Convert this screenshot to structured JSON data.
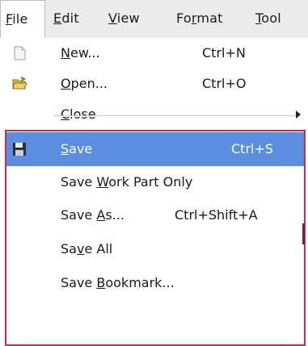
{
  "menubar": {
    "file": {
      "pre": "",
      "u": "F",
      "post": "ile"
    },
    "edit": {
      "pre": "",
      "u": "E",
      "post": "dit"
    },
    "view": {
      "pre": "",
      "u": "V",
      "post": "iew"
    },
    "format": {
      "pre": "Fo",
      "u": "r",
      "post": "mat"
    },
    "tools": {
      "pre": "",
      "u": "T",
      "post": "ool"
    }
  },
  "menu": {
    "new": {
      "pre": "",
      "u": "N",
      "post": "ew...",
      "shortcut": "Ctrl+N",
      "icon": "new-document-icon"
    },
    "open": {
      "pre": "",
      "u": "O",
      "post": "pen...",
      "shortcut": "Ctrl+O",
      "icon": "open-folder-icon"
    },
    "close": {
      "pre": "",
      "u": "C",
      "post": "lose",
      "submenu_icon": "submenu-arrow-icon"
    },
    "save": {
      "pre": "",
      "u": "S",
      "post": "ave",
      "shortcut": "Ctrl+S",
      "icon": "floppy-disk-icon"
    },
    "save_work_part": {
      "pre": "Save ",
      "u": "W",
      "post": "ork Part Only"
    },
    "save_as": {
      "pre": "Save ",
      "u": "A",
      "post": "s...",
      "shortcut": "Ctrl+Shift+A"
    },
    "save_all": {
      "pre": "Sa",
      "u": "v",
      "post": "e All"
    },
    "save_bookmark": {
      "pre": "Save ",
      "u": "B",
      "post": "ookmark..."
    }
  },
  "colors": {
    "highlight": "#5b8de0",
    "group_border": "#cc2b4a",
    "menubar_bg": "#ebebeb"
  }
}
